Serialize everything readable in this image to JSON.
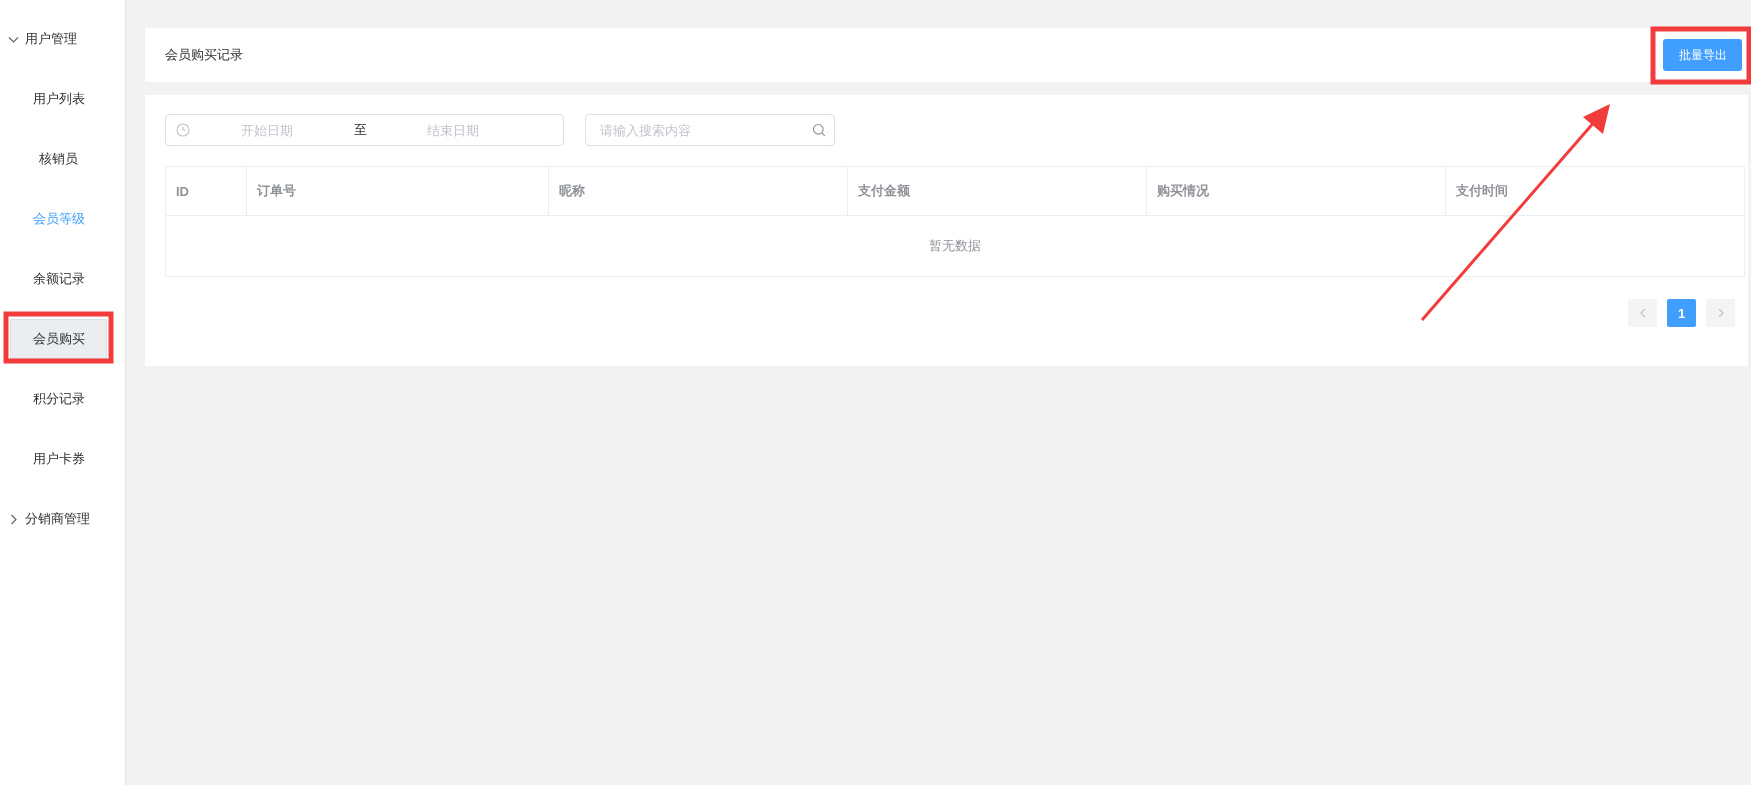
{
  "sidebar": {
    "groups": [
      {
        "label": "用户管理",
        "expanded": true,
        "items": [
          {
            "label": "用户列表",
            "selected": false,
            "highlighted": false
          },
          {
            "label": "核销员",
            "selected": false,
            "highlighted": false
          },
          {
            "label": "会员等级",
            "selected": false,
            "highlighted": true
          },
          {
            "label": "余额记录",
            "selected": false,
            "highlighted": false
          },
          {
            "label": "会员购买",
            "selected": true,
            "highlighted": false
          },
          {
            "label": "积分记录",
            "selected": false,
            "highlighted": false
          },
          {
            "label": "用户卡券",
            "selected": false,
            "highlighted": false
          }
        ]
      },
      {
        "label": "分销商管理",
        "expanded": false
      }
    ]
  },
  "header": {
    "title": "会员购买记录",
    "export_button": "批量导出"
  },
  "filters": {
    "date_range": {
      "start_placeholder": "开始日期",
      "separator": "至",
      "end_placeholder": "结束日期"
    },
    "search": {
      "placeholder": "请输入搜索内容"
    }
  },
  "table": {
    "columns": [
      "ID",
      "订单号",
      "昵称",
      "支付金额",
      "购买情况",
      "支付时间"
    ],
    "empty_text": "暂无数据"
  },
  "pagination": {
    "pages": [
      {
        "label": "1",
        "selected": true
      }
    ]
  }
}
